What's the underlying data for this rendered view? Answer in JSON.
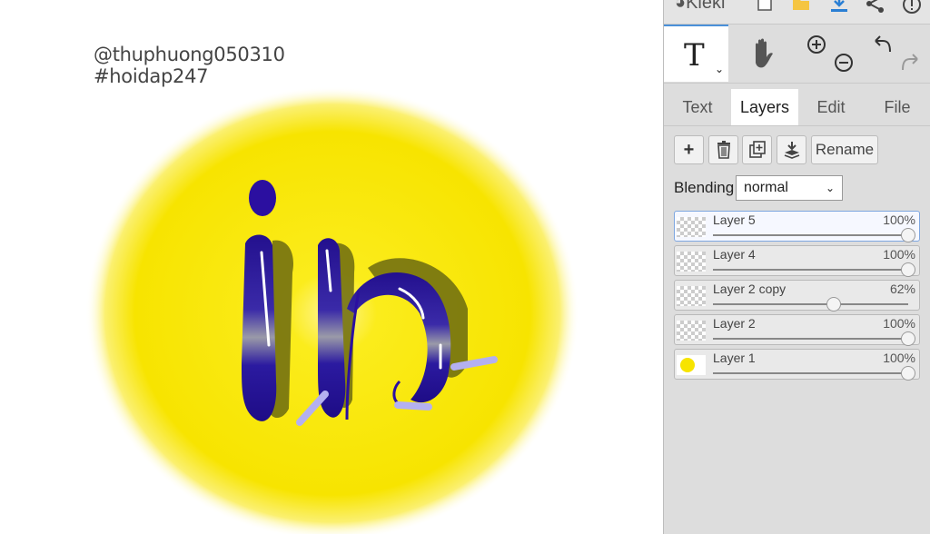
{
  "canvas": {
    "signature_line1": "@thuphuong050310",
    "signature_line2": "#hoidap247"
  },
  "app": {
    "logo": "Kleki"
  },
  "topbar": {
    "icons": [
      "new-image-icon",
      "folder-icon",
      "download-icon",
      "share-icon",
      "help-icon"
    ]
  },
  "tools": {
    "text_tool": "T",
    "hand_icon": "hand-icon",
    "zoom_icons": [
      "zoom-in-icon",
      "zoom-out-icon"
    ],
    "history_icons": [
      "undo-icon",
      "redo-icon"
    ]
  },
  "tabs": [
    {
      "label": "Text",
      "active": false
    },
    {
      "label": "Layers",
      "active": true
    },
    {
      "label": "Edit",
      "active": false
    },
    {
      "label": "File",
      "active": false
    }
  ],
  "layer_actions": {
    "add": "+",
    "delete_icon": "trash-icon",
    "duplicate_icon": "duplicate-icon",
    "merge_icon": "merge-down-icon",
    "rename": "Rename"
  },
  "blending": {
    "label": "Blending",
    "value": "normal"
  },
  "layers": [
    {
      "name": "Layer 5",
      "opacity": "100%",
      "opacity_value": 1.0,
      "selected": true
    },
    {
      "name": "Layer 4",
      "opacity": "100%",
      "opacity_value": 1.0,
      "selected": false
    },
    {
      "name": "Layer 2 copy",
      "opacity": "62%",
      "opacity_value": 0.62,
      "selected": false
    },
    {
      "name": "Layer 2",
      "opacity": "100%",
      "opacity_value": 1.0,
      "selected": false
    },
    {
      "name": "Layer 1",
      "opacity": "100%",
      "opacity_value": 1.0,
      "selected": false
    }
  ],
  "colors": {
    "sun": "#f7e400",
    "letter": "#2b0fa0",
    "accent": "#4a90d9"
  }
}
